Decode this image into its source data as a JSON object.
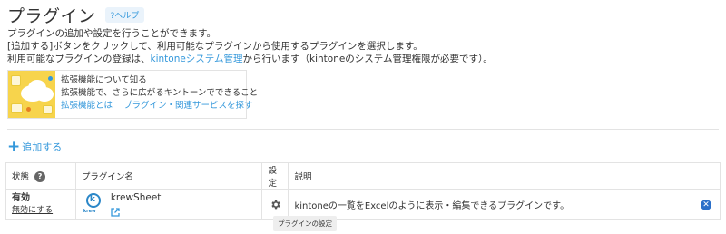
{
  "header": {
    "title": "プラグイン",
    "help_label": "?ヘルプ"
  },
  "description": {
    "line1": "プラグインの追加や設定を行うことができます。",
    "line2": "[追加する]ボタンをクリックして、利用可能なプラグインから使用するプラグインを選択します。",
    "line3_before": "利用可能なプラグインの登録は、",
    "line3_link": "kintoneシステム管理",
    "line3_after": "から行います（kintoneのシステム管理権限が必要です）。"
  },
  "banner": {
    "title": "拡張機能について知る",
    "subtitle": "拡張機能で、さらに広がるキントーンでできること",
    "link1": "拡張機能とは",
    "link2": "プラグイン・関連サービスを探す"
  },
  "add_button": {
    "label": "追加する"
  },
  "table": {
    "headers": {
      "status": "状態",
      "name": "プラグイン名",
      "setting": "設定",
      "description": "説明"
    },
    "rows": [
      {
        "status": "有効",
        "disable_label": "無効にする",
        "name": "krewSheet",
        "logo_text": "krew",
        "description": "kintoneの一覧をExcelのように表示・編集できるプラグインです。"
      }
    ]
  },
  "tooltip": {
    "text": "プラグインの設定"
  },
  "colors": {
    "accent": "#3498db",
    "remove": "#2a6fc9",
    "banner_bg": "#f7d44c"
  },
  "icons": {
    "help": "question-icon",
    "add": "plus-icon",
    "settings": "gear-icon",
    "external": "external-link-icon",
    "remove": "remove-icon"
  }
}
